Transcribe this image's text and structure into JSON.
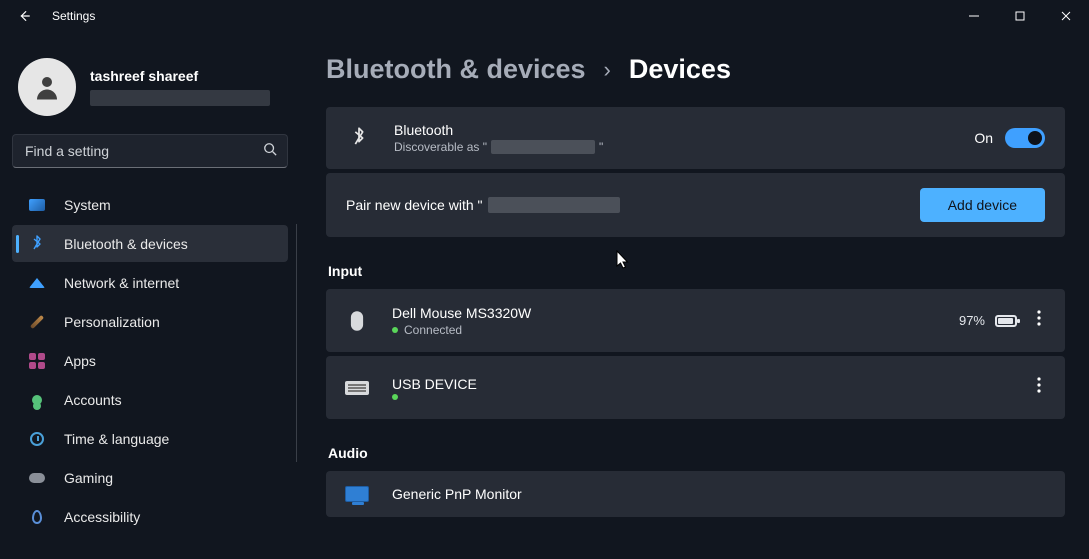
{
  "window": {
    "title": "Settings"
  },
  "user": {
    "name": "tashreef shareef"
  },
  "search": {
    "placeholder": "Find a setting"
  },
  "nav": {
    "items": [
      {
        "label": "System"
      },
      {
        "label": "Bluetooth & devices"
      },
      {
        "label": "Network & internet"
      },
      {
        "label": "Personalization"
      },
      {
        "label": "Apps"
      },
      {
        "label": "Accounts"
      },
      {
        "label": "Time & language"
      },
      {
        "label": "Gaming"
      },
      {
        "label": "Accessibility"
      }
    ]
  },
  "breadcrumb": {
    "parent": "Bluetooth & devices",
    "current": "Devices"
  },
  "bluetooth": {
    "title": "Bluetooth",
    "sub_prefix": "Discoverable as \"",
    "sub_suffix": "\"",
    "toggle_state": "On"
  },
  "pair": {
    "text_prefix": "Pair new device with \"",
    "button": "Add device"
  },
  "sections": {
    "input": "Input",
    "audio": "Audio"
  },
  "devices": {
    "mouse": {
      "name": "Dell Mouse MS3320W",
      "status": "Connected",
      "battery": "97%"
    },
    "usb": {
      "name": "USB DEVICE"
    },
    "monitor": {
      "name": "Generic PnP Monitor"
    }
  }
}
